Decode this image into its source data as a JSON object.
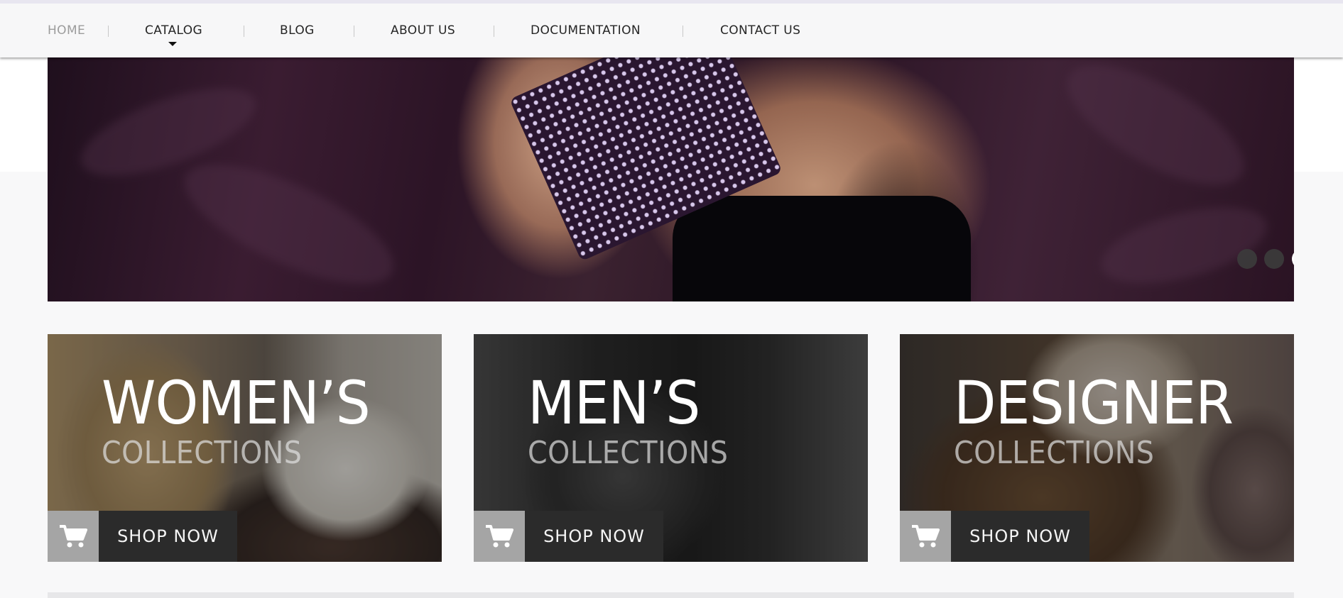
{
  "nav": {
    "items": [
      {
        "label": "HOME",
        "active": true
      },
      {
        "label": "CATALOG",
        "has_dropdown": true
      },
      {
        "label": "BLOG"
      },
      {
        "label": "ABOUT US"
      },
      {
        "label": "DOCUMENTATION"
      },
      {
        "label": "CONTACT US"
      }
    ]
  },
  "slider": {
    "slide_count": 3,
    "active_slide": 3
  },
  "collections": [
    {
      "title": "WOMEN’S",
      "subtitle": "COLLECTIONS",
      "button": "SHOP NOW",
      "icon": "cart-icon"
    },
    {
      "title": "MEN’S",
      "subtitle": "COLLECTIONS",
      "button": "SHOP NOW",
      "icon": "cart-icon"
    },
    {
      "title": "DESIGNER",
      "subtitle": "COLLECTIONS",
      "button": "SHOP NOW",
      "icon": "cart-icon"
    }
  ],
  "colors": {
    "nav_bg": "#f7f7f8",
    "active_nav": "#9c9c9c",
    "shop_button_bg": "#2b2b2b",
    "cart_box_bg": "#a5a5a5"
  }
}
